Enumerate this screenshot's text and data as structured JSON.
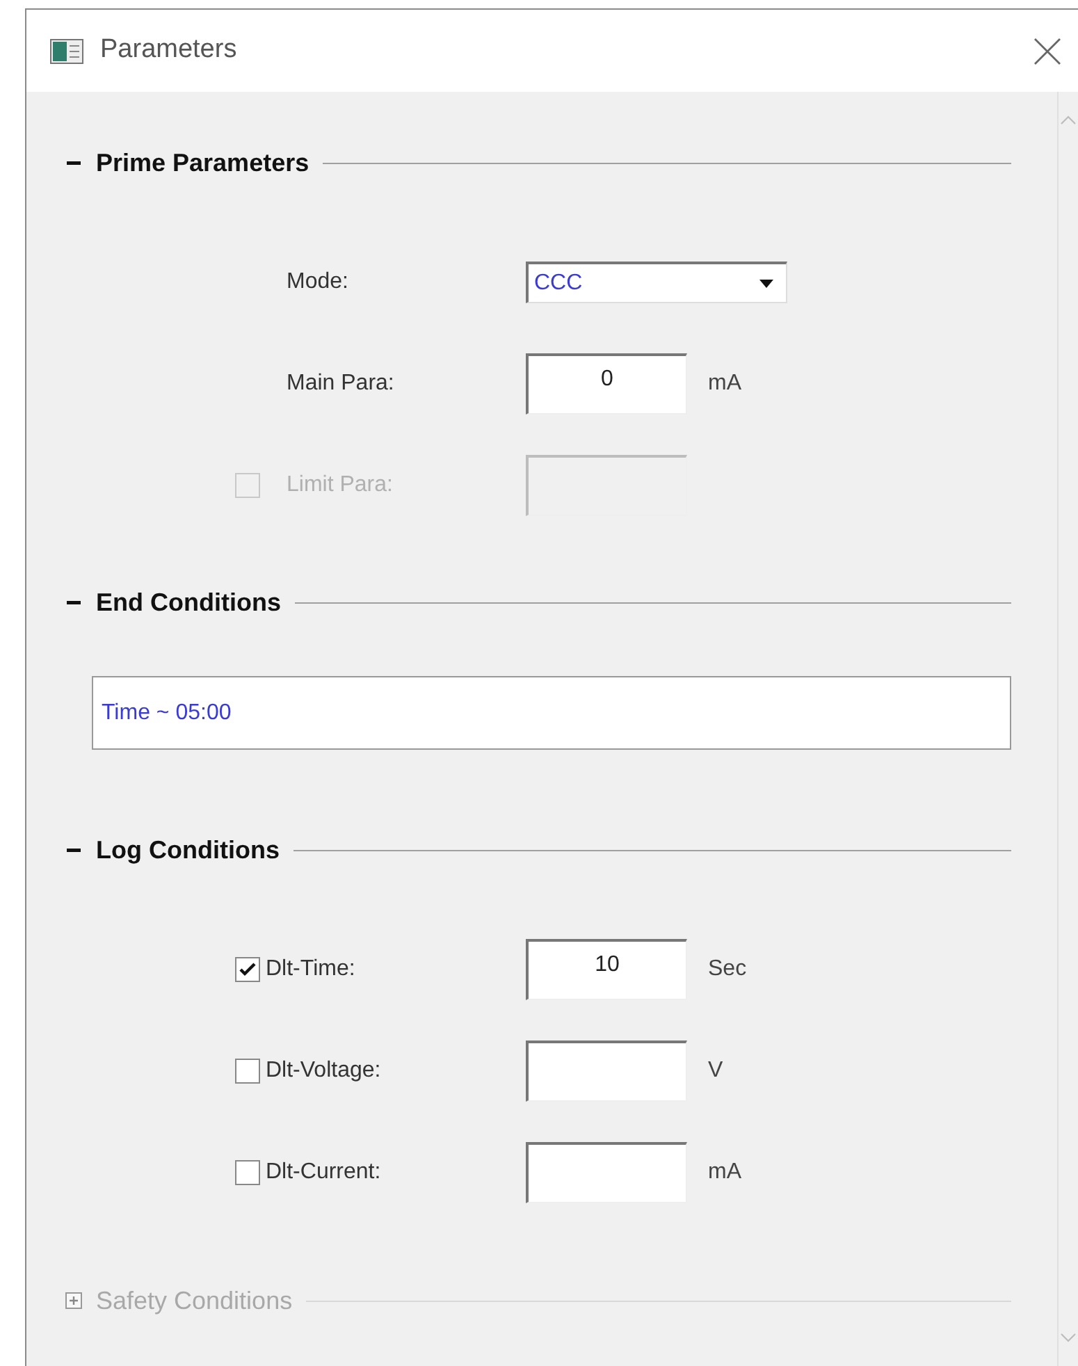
{
  "window": {
    "title": "Parameters"
  },
  "sections": [
    {
      "kind": "form",
      "title": "Prime Parameters",
      "expanded": true,
      "disabled": false,
      "rows": [
        {
          "kind": "select",
          "label": "Mode:",
          "value": "CCC"
        },
        {
          "kind": "input",
          "label": "Main Para:",
          "value": "0",
          "unit": "mA"
        },
        {
          "kind": "check_input",
          "label": "Limit Para:",
          "checked": false,
          "disabled": true
        }
      ]
    },
    {
      "kind": "summary",
      "title": "End Conditions",
      "expanded": true,
      "disabled": false,
      "value": "Time ~ 05:00"
    },
    {
      "kind": "form",
      "title": "Log Conditions",
      "expanded": true,
      "disabled": false,
      "rows": [
        {
          "kind": "check_input",
          "label": "Dlt-Time:",
          "checked": true,
          "disabled": false,
          "value": "10",
          "unit": "Sec"
        },
        {
          "kind": "check_input",
          "label": "Dlt-Voltage:",
          "checked": false,
          "disabled": false,
          "unit": "V"
        },
        {
          "kind": "check_input",
          "label": "Dlt-Current:",
          "checked": false,
          "disabled": false,
          "unit": "mA"
        }
      ]
    },
    {
      "title": "Safety Conditions",
      "expanded": false,
      "disabled": true
    }
  ]
}
